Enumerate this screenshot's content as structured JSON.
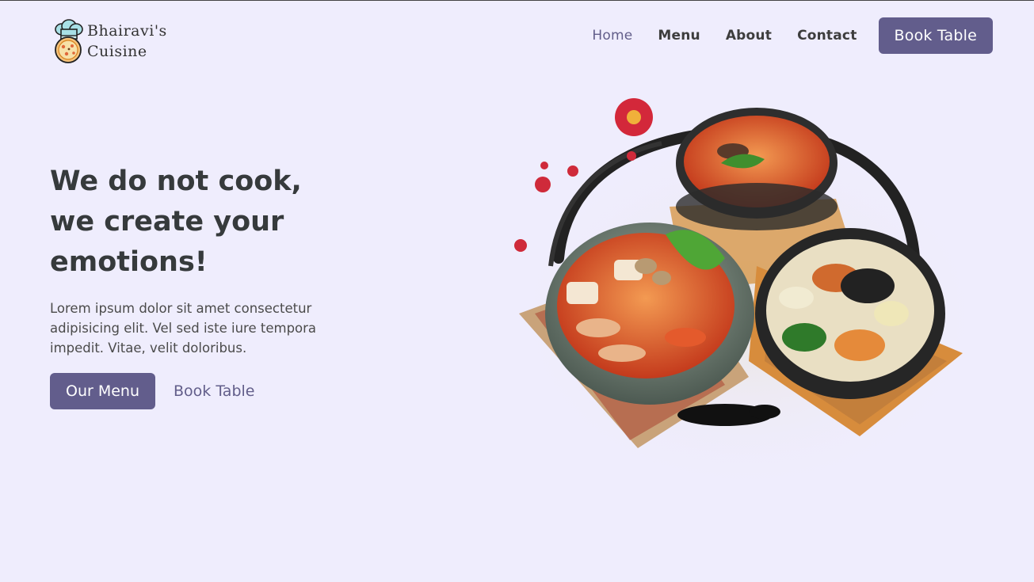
{
  "brand": {
    "line1": "Bhairavi's",
    "line2": "Cuisine",
    "logo_icon": "chef-hat-pizza-icon"
  },
  "nav": {
    "items": [
      {
        "label": "Home",
        "active": true
      },
      {
        "label": "Menu",
        "active": false
      },
      {
        "label": "About",
        "active": false
      },
      {
        "label": "Contact",
        "active": false
      }
    ],
    "cta_label": "Book Table"
  },
  "hero": {
    "title_lines": [
      "We do not cook,",
      "we create your",
      "emotions!"
    ],
    "description": "Lorem ipsum dolor sit amet consectetur adipisicing elit. Vel sed iste iure tempora impedit. Vitae, velit doloribus.",
    "primary_button": "Our Menu",
    "secondary_link": "Book Table",
    "image_icon": "korean-food-bowls-image"
  },
  "colors": {
    "background": "#efedfd",
    "accent": "#625d8c",
    "heading": "#363a3c"
  }
}
